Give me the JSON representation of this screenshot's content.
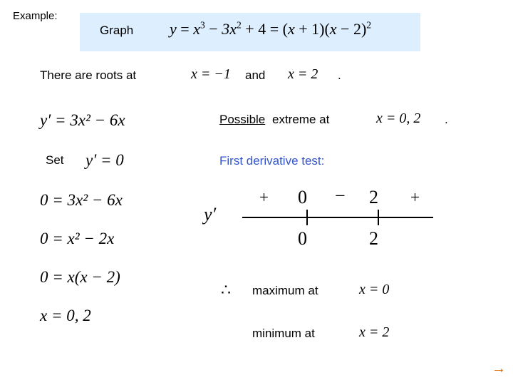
{
  "slide": {
    "example_label": "Example:",
    "graph_word": "Graph",
    "next_arrow": "→",
    "colors": {
      "highlight_band": "#ddeeff",
      "heading_blue": "#3355cc",
      "arrow_orange": "#dd6600"
    }
  },
  "equation": {
    "y": "y",
    "eq": "=",
    "rhs_part1": "x",
    "rhs_exp1": "3",
    "minus": "−",
    "rhs_part2": "3x",
    "rhs_exp2": "2",
    "plus": "+",
    "rhs_const": "4",
    "factored_open": "(",
    "factored_a": "x",
    "factored_plus": "+ 1",
    "factored_close": ")",
    "factored_open2": "(",
    "factored_b": "x",
    "factored_minus": "− 2",
    "factored_close2": ")",
    "factored_exp": "2",
    "full_text": "y = x³ − 3x² + 4 = (x + 1)(x − 2)²"
  },
  "roots": {
    "lead_text": "There are roots at",
    "root1": "x = −1",
    "conjunction": "and",
    "root2": "x = 2",
    "period": "."
  },
  "left_column": {
    "derivative": "y′ = 3x² − 6x",
    "set_word": "Set",
    "set_equation": "y′ = 0",
    "step1": "0 = 3x² − 6x",
    "step2": "0 = x² − 2x",
    "step3": "0 = x(x − 2)",
    "step4": "x = 0, 2"
  },
  "right_column": {
    "possible_word": "Possible",
    "extreme_text": "extreme at",
    "extreme_values": "x = 0, 2",
    "extreme_period": ".",
    "fdt_heading": "First derivative test:"
  },
  "sign_chart": {
    "label": "y′",
    "signs": [
      "+",
      "−",
      "+"
    ],
    "critical_points_top": [
      "0",
      "2"
    ],
    "critical_points_bottom": [
      "0",
      "2"
    ]
  },
  "conclusion": {
    "therefore_symbol": "∴",
    "max_text": "maximum at",
    "max_value": "x = 0",
    "min_text": "minimum at",
    "min_value": "x = 2"
  }
}
